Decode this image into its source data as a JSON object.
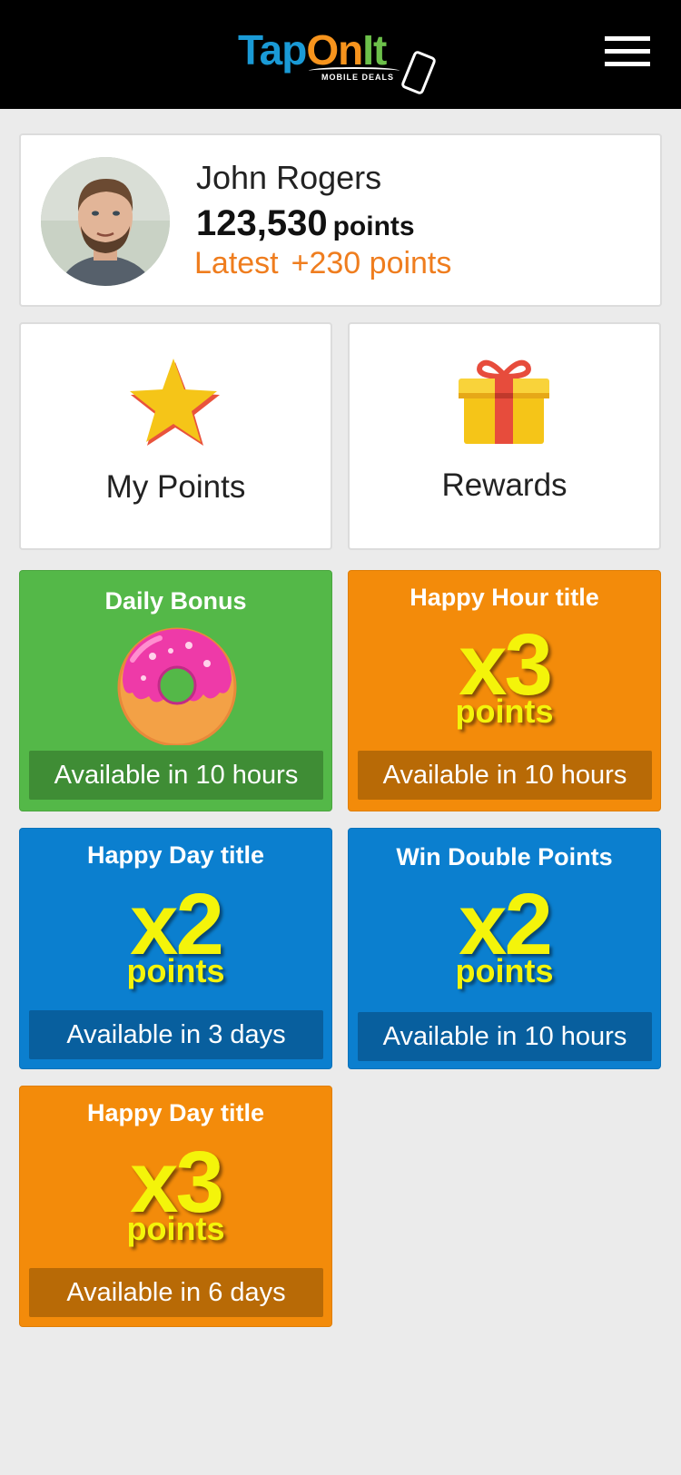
{
  "header": {
    "logo": {
      "brand": "TapOnIt",
      "tagline": "MOBILE DEALS"
    },
    "menu_icon": "hamburger-menu-icon"
  },
  "profile": {
    "name": "John Rogers",
    "points_value": "123,530",
    "points_unit": "points",
    "latest_label": "Latest",
    "latest_value": "+230 points",
    "accent_color": "#ef7d1e"
  },
  "tiles": {
    "my_points": {
      "label": "My Points",
      "icon": "star-icon"
    },
    "rewards": {
      "label": "Rewards",
      "icon": "gift-icon"
    }
  },
  "promos": [
    {
      "title": "Daily Bonus",
      "icon": "donut-icon",
      "availability": "Available in 10 hours",
      "color": "#54b848"
    },
    {
      "title": "Happy Hour title",
      "multiplier": "x3",
      "unit": "points",
      "availability": "Available in 10 hours",
      "color": "#f38b0a"
    },
    {
      "title": "Happy Day title",
      "multiplier": "x2",
      "unit": "points",
      "availability": "Available in 3 days",
      "color": "#0b7fcf"
    },
    {
      "title": "Win Double Points",
      "multiplier": "x2",
      "unit": "points",
      "availability": "Available in 10 hours",
      "color": "#0b7fcf"
    },
    {
      "title": "Happy Day title",
      "multiplier": "x3",
      "unit": "points",
      "availability": "Available in 6 days",
      "color": "#f38b0a"
    }
  ]
}
